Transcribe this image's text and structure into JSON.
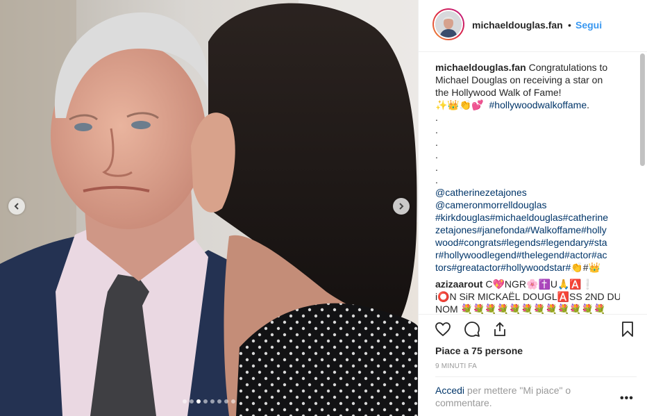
{
  "post": {
    "media": {
      "slides_count": 8,
      "active_slide": 3
    }
  },
  "header": {
    "username": "michaeldouglas.fan",
    "separator": "•",
    "follow_label": "Segui"
  },
  "caption": {
    "username": "michaeldouglas.fan",
    "text_lines": [
      "Congratulations to",
      "Michael Douglas on receiving a star on",
      "the Hollywood Walk of Fame!"
    ],
    "emojis": "✨👑👏💕",
    "hashtag": "#hollywoodwalkoffame",
    "hashtag_suffix": " .",
    "dots": [
      ".",
      ".",
      ".",
      ".",
      ".",
      "."
    ],
    "mention_lines": [
      "@catherinezetajones",
      "@cameronmorrelldouglas",
      "#kirkdouglas#michaeldouglas#catherine",
      "zetajones#janefonda#Walkoffame#holly",
      "wood#congrats#legends#legendary#sta",
      "r#hollywoodlegend#thelegend#actor#ac",
      "tors#greatactor#hollywoodstar#"
    ],
    "end_emojis": "👏#👑"
  },
  "comment": {
    "username": "azizaarout",
    "line1": "C💖NGR🌸✝️U🙏🅰️❕",
    "line2": "i⭕N SiR MICKAËL DOUGL🅰️SS 2ND DU",
    "line3": "NOM 💐💐💐💐💐💐💐💐💐💐💐💐"
  },
  "likes_text": "Piace a 75 persone",
  "timestamp": "9 MINUTI FA",
  "login_prompt": {
    "link": "Accedi",
    "text": " per mettere \"Mi piace\" o commentare."
  },
  "more_label": "•••",
  "icons": [
    "heart-icon",
    "comment-icon",
    "share-icon",
    "bookmark-icon",
    "chevron-left-icon",
    "chevron-right-icon"
  ]
}
